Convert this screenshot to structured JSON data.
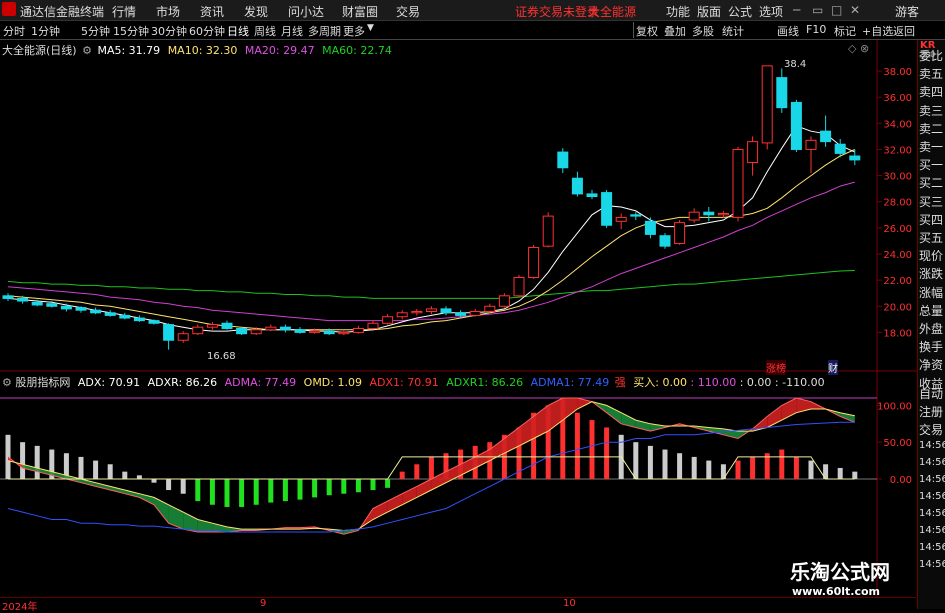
{
  "menu": {
    "app_title": "通达信金融终端",
    "items": [
      "行情",
      "市场",
      "资讯",
      "发现",
      "问小达",
      "财富圈",
      "交易"
    ],
    "notice": "证券交易未登录",
    "stock_name": "大全能源",
    "right": [
      "功能",
      "版面",
      "公式",
      "选项"
    ],
    "guest": "游客"
  },
  "toolbar": {
    "periods": [
      "分时",
      "1分钟",
      "5分钟",
      "15分钟",
      "30分钟",
      "60分钟",
      "日线",
      "周线",
      "月线",
      "多周期",
      "更多"
    ],
    "active": "日线",
    "right": [
      "复权",
      "叠加",
      "多股",
      "统计",
      "画线",
      "F10",
      "标记",
      "+自选",
      "返回"
    ]
  },
  "price_legend": {
    "title": "大全能源(日线)",
    "ma5": "MA5: 31.79",
    "ma10": "MA10: 32.30",
    "ma20": "MA20: 29.47",
    "ma60": "MA60: 22.74"
  },
  "indicator_legend": {
    "title": "股朋指标网",
    "adx": "ADX: 70.91",
    "adxr": "ADXR: 86.26",
    "adma": "ADMA: 77.49",
    "omd": "OMD: 1.09",
    "adx1": "ADX1: 70.91",
    "adxr1": "ADXR1: 86.26",
    "adma1": "ADMA1: 77.49",
    "strong": "强",
    "buy": "买入: 0.00",
    "v110": ": 110.00",
    "v0": ": 0.00",
    "vm110": ": -110.00"
  },
  "price_axis": [
    "38.00",
    "36.00",
    "34.00",
    "32.00",
    "30.00",
    "28.00",
    "26.00",
    "24.00",
    "22.00",
    "20.00",
    "18.00"
  ],
  "ind_axis": [
    "100.00",
    "50.00",
    "0.00"
  ],
  "annotations": {
    "high": "38.4",
    "low": "16.68",
    "tag1": "涨榜",
    "tag2": "财"
  },
  "sidebar": {
    "code": "KR",
    "code_sub": "300",
    "items": [
      "委比",
      "卖五",
      "卖四",
      "卖三",
      "卖二",
      "卖一",
      "买一",
      "买二",
      "买三",
      "买四",
      "买五",
      "现价",
      "涨跌",
      "涨幅",
      "总量",
      "外盘",
      "换手",
      "净资",
      "收益",
      "自动",
      "注册",
      "交易"
    ],
    "times": [
      "14:56",
      "14:56",
      "14:56",
      "14:56",
      "14:56",
      "14:56",
      "14:56",
      "14:56"
    ]
  },
  "dates": [
    "2024年",
    "9",
    "10"
  ],
  "watermark": {
    "name": "乐淘公式网",
    "url": "www.60lt.com"
  },
  "colors": {
    "up": "#ff3030",
    "down": "#19d7e6",
    "ma5": "#ffffff",
    "ma10": "#ffe36e",
    "ma20": "#d040d0",
    "ma60": "#20c020"
  },
  "chart_data": {
    "type": "candlestick",
    "price_range": [
      16.5,
      39
    ],
    "indicator_range": [
      -110,
      110
    ],
    "candles": [
      [
        20.8,
        20.6,
        21.0,
        20.4
      ],
      [
        20.6,
        20.4,
        20.8,
        20.2
      ],
      [
        20.3,
        20.1,
        20.5,
        20.0
      ],
      [
        20.2,
        20.0,
        20.4,
        19.9
      ],
      [
        20.0,
        19.8,
        20.2,
        19.6
      ],
      [
        19.9,
        19.7,
        20.0,
        19.5
      ],
      [
        19.7,
        19.5,
        19.9,
        19.4
      ],
      [
        19.5,
        19.3,
        19.7,
        19.2
      ],
      [
        19.3,
        19.1,
        19.5,
        19.0
      ],
      [
        19.1,
        18.9,
        19.3,
        18.8
      ],
      [
        18.9,
        18.7,
        19.0,
        18.6
      ],
      [
        18.6,
        17.4,
        18.7,
        16.68
      ],
      [
        17.4,
        17.9,
        18.1,
        17.2
      ],
      [
        17.9,
        18.4,
        18.6,
        17.8
      ],
      [
        18.4,
        18.6,
        18.8,
        18.2
      ],
      [
        18.7,
        18.3,
        18.9,
        18.2
      ],
      [
        18.3,
        17.9,
        18.4,
        17.8
      ],
      [
        17.9,
        18.2,
        18.4,
        17.8
      ],
      [
        18.2,
        18.4,
        18.6,
        18.1
      ],
      [
        18.4,
        18.2,
        18.6,
        18.0
      ],
      [
        18.2,
        18.0,
        18.4,
        17.9
      ],
      [
        18.0,
        18.1,
        18.3,
        17.9
      ],
      [
        18.1,
        17.9,
        18.3,
        17.8
      ],
      [
        17.9,
        18.0,
        18.2,
        17.8
      ],
      [
        18.0,
        18.3,
        18.5,
        17.9
      ],
      [
        18.3,
        18.7,
        18.9,
        18.2
      ],
      [
        18.7,
        19.2,
        19.4,
        18.6
      ],
      [
        19.2,
        19.5,
        19.7,
        19.0
      ],
      [
        19.5,
        19.6,
        19.8,
        19.3
      ],
      [
        19.6,
        19.8,
        20.0,
        19.4
      ],
      [
        19.8,
        19.5,
        20.0,
        19.3
      ],
      [
        19.5,
        19.3,
        19.7,
        19.1
      ],
      [
        19.3,
        19.6,
        19.8,
        19.2
      ],
      [
        19.6,
        20.0,
        20.2,
        19.5
      ],
      [
        20.0,
        20.8,
        21.0,
        19.9
      ],
      [
        20.8,
        22.2,
        22.4,
        20.7
      ],
      [
        22.2,
        24.5,
        24.7,
        22.1
      ],
      [
        24.6,
        26.9,
        27.2,
        24.5
      ],
      [
        31.8,
        30.6,
        32.1,
        30.2
      ],
      [
        29.8,
        28.6,
        30.3,
        28.4
      ],
      [
        28.6,
        28.4,
        28.9,
        28.2
      ],
      [
        28.7,
        26.2,
        28.9,
        26.0
      ],
      [
        26.5,
        26.8,
        27.1,
        25.9
      ],
      [
        27.0,
        26.9,
        27.2,
        26.6
      ],
      [
        26.5,
        25.5,
        26.8,
        25.2
      ],
      [
        25.4,
        24.6,
        25.6,
        24.4
      ],
      [
        24.8,
        26.4,
        26.6,
        24.7
      ],
      [
        26.6,
        27.2,
        27.5,
        26.4
      ],
      [
        27.2,
        27.0,
        27.6,
        26.5
      ],
      [
        27.0,
        27.1,
        27.3,
        26.8
      ],
      [
        26.8,
        32.0,
        32.2,
        26.5
      ],
      [
        31.0,
        32.6,
        33.0,
        30.0
      ],
      [
        32.5,
        38.4,
        38.4,
        32.0
      ],
      [
        37.5,
        35.2,
        38.2,
        34.8
      ],
      [
        35.6,
        32.0,
        35.8,
        31.8
      ],
      [
        32.0,
        32.7,
        33.0,
        30.2
      ],
      [
        33.4,
        32.6,
        34.6,
        32.2
      ],
      [
        32.4,
        31.7,
        32.8,
        31.4
      ],
      [
        31.5,
        31.2,
        32.0,
        30.8
      ]
    ],
    "ma5": [
      20.6,
      20.5,
      20.4,
      20.3,
      20.1,
      19.9,
      19.7,
      19.5,
      19.3,
      19.1,
      18.9,
      18.6,
      18.4,
      18.2,
      18.1,
      18.1,
      18.2,
      18.2,
      18.2,
      18.2,
      18.2,
      18.1,
      18.1,
      18.0,
      18.1,
      18.2,
      18.5,
      18.8,
      19.1,
      19.3,
      19.5,
      19.5,
      19.5,
      19.6,
      19.8,
      20.4,
      21.3,
      22.6,
      24.2,
      25.6,
      27.0,
      27.7,
      27.6,
      27.3,
      26.6,
      26.1,
      26.1,
      26.2,
      26.4,
      26.6,
      27.3,
      28.3,
      30.3,
      32.1,
      33.8,
      33.4,
      33.2,
      32.3,
      31.8
    ],
    "ma10": [
      20.8,
      20.7,
      20.6,
      20.5,
      20.4,
      20.3,
      20.1,
      20.0,
      19.8,
      19.6,
      19.4,
      19.2,
      19.0,
      18.8,
      18.6,
      18.5,
      18.4,
      18.3,
      18.2,
      18.2,
      18.2,
      18.2,
      18.2,
      18.2,
      18.2,
      18.2,
      18.3,
      18.5,
      18.6,
      18.8,
      18.9,
      19.1,
      19.3,
      19.5,
      19.7,
      20.0,
      20.5,
      21.2,
      22.0,
      22.9,
      23.8,
      24.6,
      25.4,
      26.0,
      26.4,
      26.6,
      26.8,
      26.8,
      26.8,
      26.8,
      26.9,
      27.1,
      27.5,
      28.3,
      29.2,
      30.0,
      30.8,
      31.5,
      32.0
    ],
    "ma20": [
      21.5,
      21.4,
      21.3,
      21.2,
      21.1,
      21.0,
      20.9,
      20.7,
      20.6,
      20.5,
      20.3,
      20.2,
      20.0,
      19.9,
      19.7,
      19.6,
      19.5,
      19.4,
      19.3,
      19.2,
      19.1,
      19.0,
      18.9,
      18.9,
      18.9,
      18.9,
      18.9,
      18.9,
      19.0,
      19.0,
      19.1,
      19.2,
      19.3,
      19.4,
      19.5,
      19.7,
      20.0,
      20.3,
      20.7,
      21.1,
      21.5,
      22.0,
      22.5,
      22.9,
      23.3,
      23.7,
      24.1,
      24.5,
      24.9,
      25.3,
      25.8,
      26.2,
      26.8,
      27.3,
      27.8,
      28.3,
      28.7,
      29.2,
      29.5
    ],
    "ma60": [
      21.9,
      21.8,
      21.8,
      21.7,
      21.7,
      21.6,
      21.6,
      21.5,
      21.5,
      21.4,
      21.4,
      21.3,
      21.3,
      21.2,
      21.2,
      21.1,
      21.1,
      21.0,
      21.0,
      20.9,
      20.9,
      20.8,
      20.8,
      20.7,
      20.7,
      20.6,
      20.6,
      20.6,
      20.6,
      20.6,
      20.6,
      20.6,
      20.6,
      20.6,
      20.6,
      20.7,
      20.8,
      20.9,
      21.0,
      21.1,
      21.2,
      21.2,
      21.3,
      21.4,
      21.5,
      21.6,
      21.7,
      21.7,
      21.8,
      21.9,
      22.0,
      22.1,
      22.2,
      22.3,
      22.4,
      22.5,
      22.6,
      22.7,
      22.74
    ],
    "bars": [
      60,
      50,
      45,
      40,
      35,
      30,
      25,
      20,
      10,
      5,
      -5,
      -15,
      -20,
      -30,
      -35,
      -38,
      -38,
      -35,
      -32,
      -30,
      -28,
      -25,
      -22,
      -20,
      -18,
      -15,
      -12,
      10,
      20,
      30,
      35,
      40,
      45,
      50,
      60,
      70,
      90,
      100,
      110,
      90,
      80,
      70,
      60,
      50,
      45,
      40,
      35,
      30,
      25,
      20,
      25,
      30,
      35,
      40,
      30,
      25,
      20,
      15,
      10
    ],
    "adx": [
      30,
      15,
      10,
      5,
      0,
      -5,
      -10,
      -15,
      -20,
      -25,
      -35,
      -60,
      -68,
      -72,
      -72,
      -72,
      -70,
      -70,
      -68,
      -66,
      -66,
      -65,
      -70,
      -75,
      -70,
      -40,
      -30,
      -20,
      -10,
      0,
      10,
      20,
      30,
      40,
      55,
      70,
      85,
      100,
      110,
      110,
      105,
      90,
      75,
      70,
      65,
      70,
      75,
      70,
      65,
      60,
      55,
      68,
      85,
      100,
      110,
      105,
      95,
      85,
      77
    ],
    "adxr": [
      25,
      20,
      15,
      10,
      5,
      0,
      -5,
      -10,
      -15,
      -20,
      -25,
      -35,
      -45,
      -55,
      -60,
      -65,
      -68,
      -68,
      -68,
      -68,
      -68,
      -67,
      -68,
      -70,
      -68,
      -55,
      -45,
      -35,
      -25,
      -15,
      -5,
      5,
      15,
      25,
      35,
      45,
      55,
      65,
      80,
      95,
      105,
      100,
      90,
      80,
      75,
      72,
      72,
      72,
      70,
      68,
      65,
      65,
      70,
      80,
      90,
      95,
      95,
      90,
      86
    ],
    "adma": [
      -40,
      -45,
      -50,
      -55,
      -55,
      -60,
      -60,
      -62,
      -62,
      -64,
      -64,
      -66,
      -68,
      -70,
      -70,
      -72,
      -72,
      -72,
      -72,
      -72,
      -72,
      -72,
      -72,
      -70,
      -68,
      -65,
      -60,
      -55,
      -50,
      -45,
      -40,
      -30,
      -20,
      -10,
      0,
      10,
      20,
      30,
      35,
      40,
      45,
      50,
      50,
      55,
      55,
      60,
      60,
      60,
      62,
      64,
      66,
      68,
      70,
      72,
      74,
      75,
      76,
      77,
      77
    ],
    "signal": [
      0,
      0,
      0,
      0,
      0,
      0,
      0,
      0,
      0,
      0,
      0,
      0,
      0,
      0,
      0,
      0,
      0,
      0,
      0,
      0,
      0,
      0,
      0,
      0,
      0,
      0,
      0,
      30,
      30,
      30,
      30,
      30,
      30,
      30,
      30,
      30,
      30,
      30,
      30,
      30,
      30,
      30,
      30,
      0,
      0,
      0,
      0,
      0,
      0,
      0,
      30,
      30,
      30,
      30,
      30,
      30,
      0,
      0,
      0
    ]
  }
}
